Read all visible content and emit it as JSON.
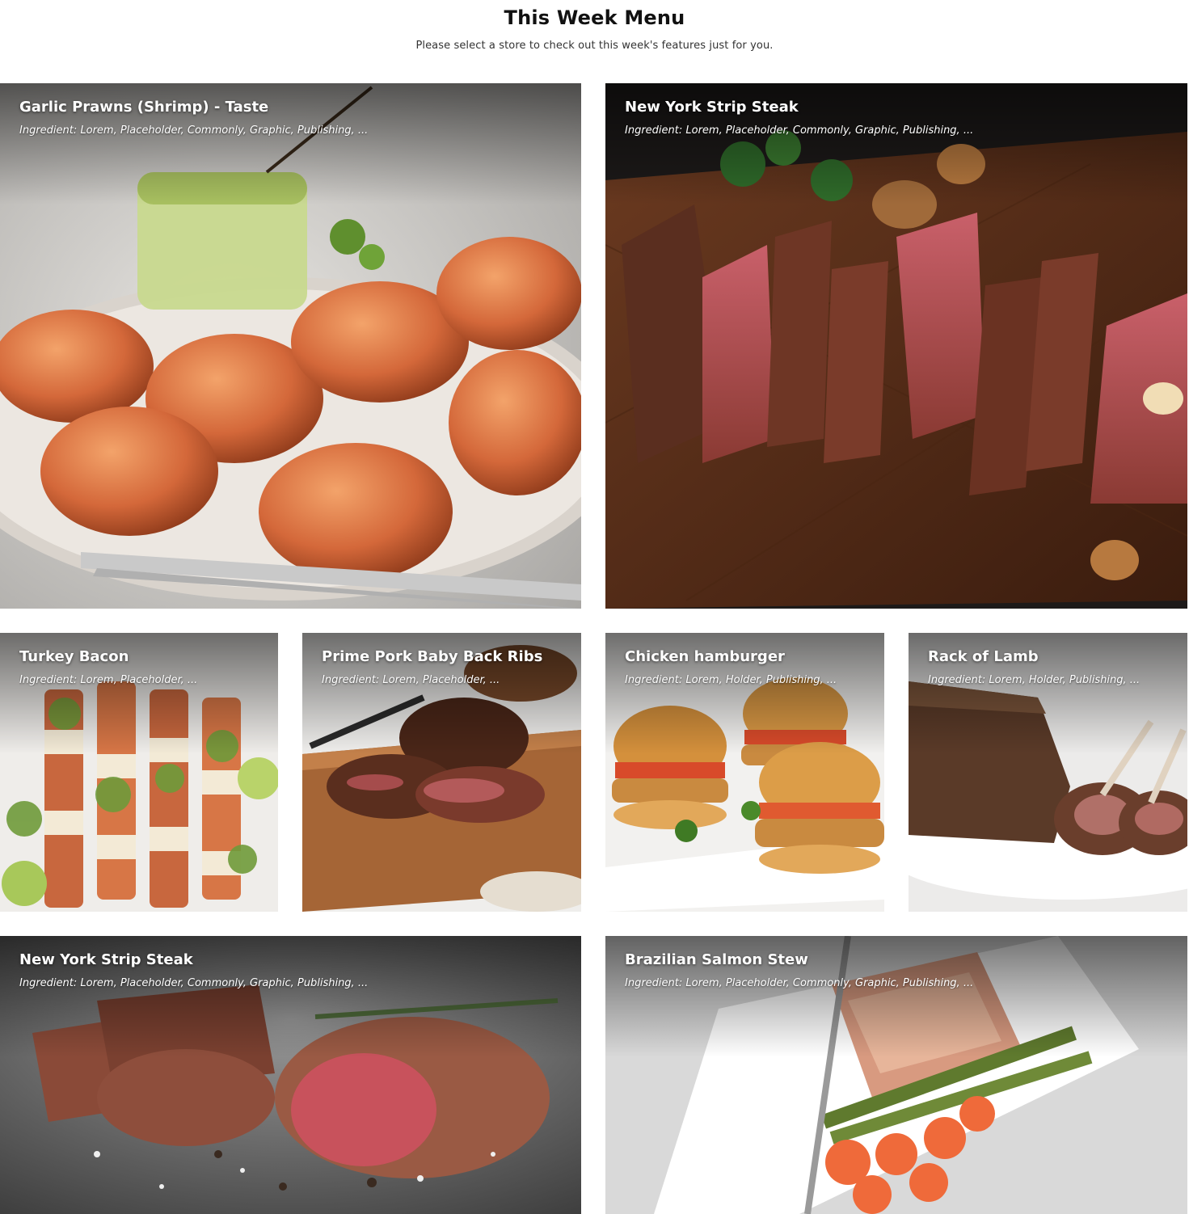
{
  "header": {
    "title": "This Week Menu",
    "subtitle": "Please select a store to check out this week's features just for you."
  },
  "cards": [
    {
      "name": "Garlic Prawns (Shrimp) - Taste",
      "ingredients": "Ingredient: Lorem, Placeholder, Commonly, Graphic, Publishing, ...",
      "image": "garlic-prawns-photo"
    },
    {
      "name": "New York Strip Steak",
      "ingredients": "Ingredient: Lorem, Placeholder, Commonly, Graphic, Publishing, ...",
      "image": "sliced-strip-steak-photo"
    },
    {
      "name": "Turkey Bacon",
      "ingredients": "Ingredient: Lorem, Placeholder, ...",
      "image": "skewers-photo"
    },
    {
      "name": "Prime Pork Baby Back Ribs",
      "ingredients": "Ingredient: Lorem, Placeholder, ...",
      "image": "pork-ribs-photo"
    },
    {
      "name": "Chicken hamburger",
      "ingredients": "Ingredient: Lorem, Holder, Publishing, ...",
      "image": "chicken-burgers-photo"
    },
    {
      "name": "Rack of Lamb",
      "ingredients": "Ingredient: Lorem, Holder, Publishing, ...",
      "image": "lamb-rack-photo"
    },
    {
      "name": "New York Strip Steak",
      "ingredients": "Ingredient: Lorem, Placeholder, Commonly, Graphic, Publishing, ...",
      "image": "grilled-steak-photo"
    },
    {
      "name": "Brazilian Salmon Stew",
      "ingredients": "Ingredient: Lorem, Placeholder, Commonly, Graphic, Publishing, ...",
      "image": "salmon-plate-photo"
    }
  ]
}
